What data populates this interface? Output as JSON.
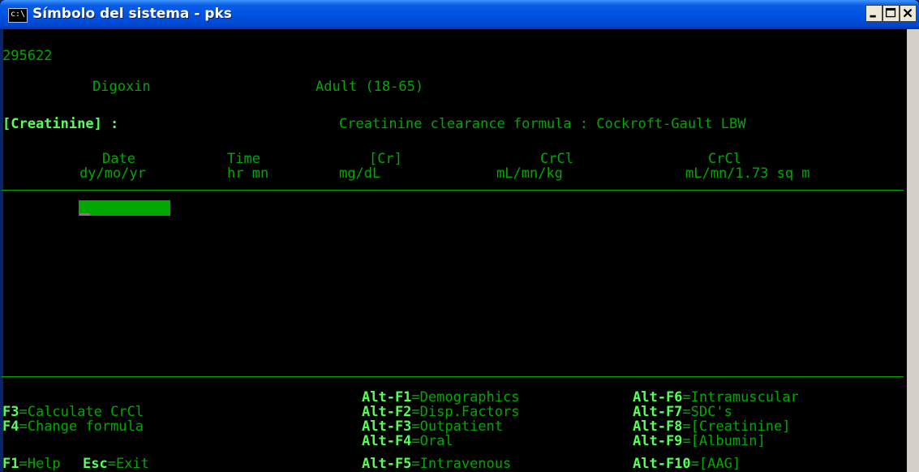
{
  "window": {
    "title": "Símbolo del sistema - pks",
    "icon": "console-icon",
    "icon_text": "c:\\"
  },
  "header": {
    "id": "295622",
    "drug": "Digoxin",
    "age_group": "Adult (18-65)"
  },
  "section": {
    "label": "[Creatinine] :",
    "formula_info": "Creatinine clearance formula : Cockroft-Gault LBW"
  },
  "table": {
    "columns": [
      {
        "title": "Date",
        "unit": "dy/mo/yr"
      },
      {
        "title": "Time",
        "unit": "hr mn"
      },
      {
        "title": "[Cr]",
        "unit": "mg/dL"
      },
      {
        "title": "CrCl",
        "unit": "mL/mn/kg"
      },
      {
        "title": "CrCl",
        "unit": "mL/mn/1.73 sq m"
      }
    ],
    "input_value": ""
  },
  "footer": {
    "left": [
      {
        "key": "F3",
        "label": "=Calculate CrCl"
      },
      {
        "key": "F4",
        "label": "=Change formula"
      },
      {
        "key": "F1",
        "label": "=Help"
      },
      {
        "key": "Esc",
        "label": "=Exit"
      }
    ],
    "middle": [
      {
        "key": "Alt-F1",
        "label": "=Demographics"
      },
      {
        "key": "Alt-F2",
        "label": "=Disp.Factors"
      },
      {
        "key": "Alt-F3",
        "label": "=Outpatient"
      },
      {
        "key": "Alt-F4",
        "label": "=Oral"
      },
      {
        "key": "Alt-F5",
        "label": "=Intravenous"
      }
    ],
    "right": [
      {
        "key": "Alt-F6",
        "label": "=Intramuscular"
      },
      {
        "key": "Alt-F7",
        "label": "=SDC's"
      },
      {
        "key": "Alt-F8",
        "label": "=[Creatinine]"
      },
      {
        "key": "Alt-F9",
        "label": "=[Albumin]"
      },
      {
        "key": "Alt-F10",
        "label": "=[AAG]"
      }
    ]
  },
  "colors": {
    "background": "#000000",
    "text": "#00a800",
    "highlight": "#55ff55",
    "input_field": "#00a800",
    "cursor": "#c050c0"
  }
}
